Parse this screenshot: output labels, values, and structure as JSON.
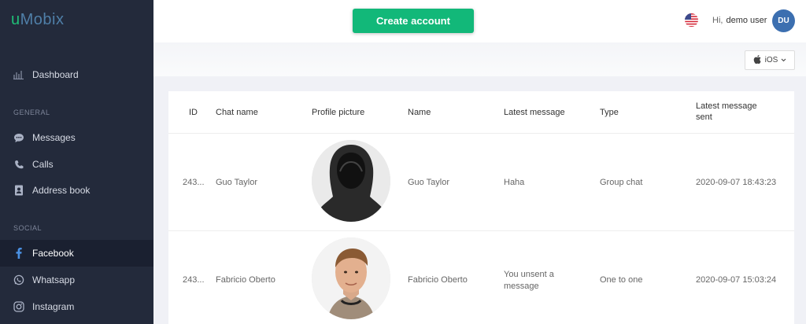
{
  "app": {
    "logo_u": "u",
    "logo_rest": "Mobix"
  },
  "sidebar": {
    "dashboard": "Dashboard",
    "general_label": "GENERAL",
    "messages": "Messages",
    "calls": "Calls",
    "address_book": "Address book",
    "social_label": "SOCIAL",
    "facebook": "Facebook",
    "whatsapp": "Whatsapp",
    "instagram": "Instagram"
  },
  "topbar": {
    "create_account": "Create account",
    "greeting": "Hi,",
    "user_name": "demo user",
    "avatar_initials": "DU"
  },
  "filter": {
    "os_value": "iOS"
  },
  "table": {
    "headers": {
      "id": "ID",
      "chat_name": "Chat name",
      "profile_picture": "Profile picture",
      "name": "Name",
      "latest_message": "Latest message",
      "type": "Type",
      "latest_message_sent_1": "Latest message",
      "latest_message_sent_2": "sent"
    },
    "rows": [
      {
        "id": "243...",
        "chat_name": "Guo Taylor",
        "name": "Guo Taylor",
        "latest_message": "Haha",
        "latest_message_2": "",
        "type": "Group chat",
        "sent": "2020-09-07 18:43:23"
      },
      {
        "id": "243...",
        "chat_name": "Fabricio Oberto",
        "name": "Fabricio Oberto",
        "latest_message": "You unsent a",
        "latest_message_2": "message",
        "type": "One to one",
        "sent": "2020-09-07 15:03:24"
      }
    ]
  },
  "colors": {
    "sidebar": "#232a3b",
    "accent_green": "#12b879",
    "avatar": "#3c6fb0"
  }
}
